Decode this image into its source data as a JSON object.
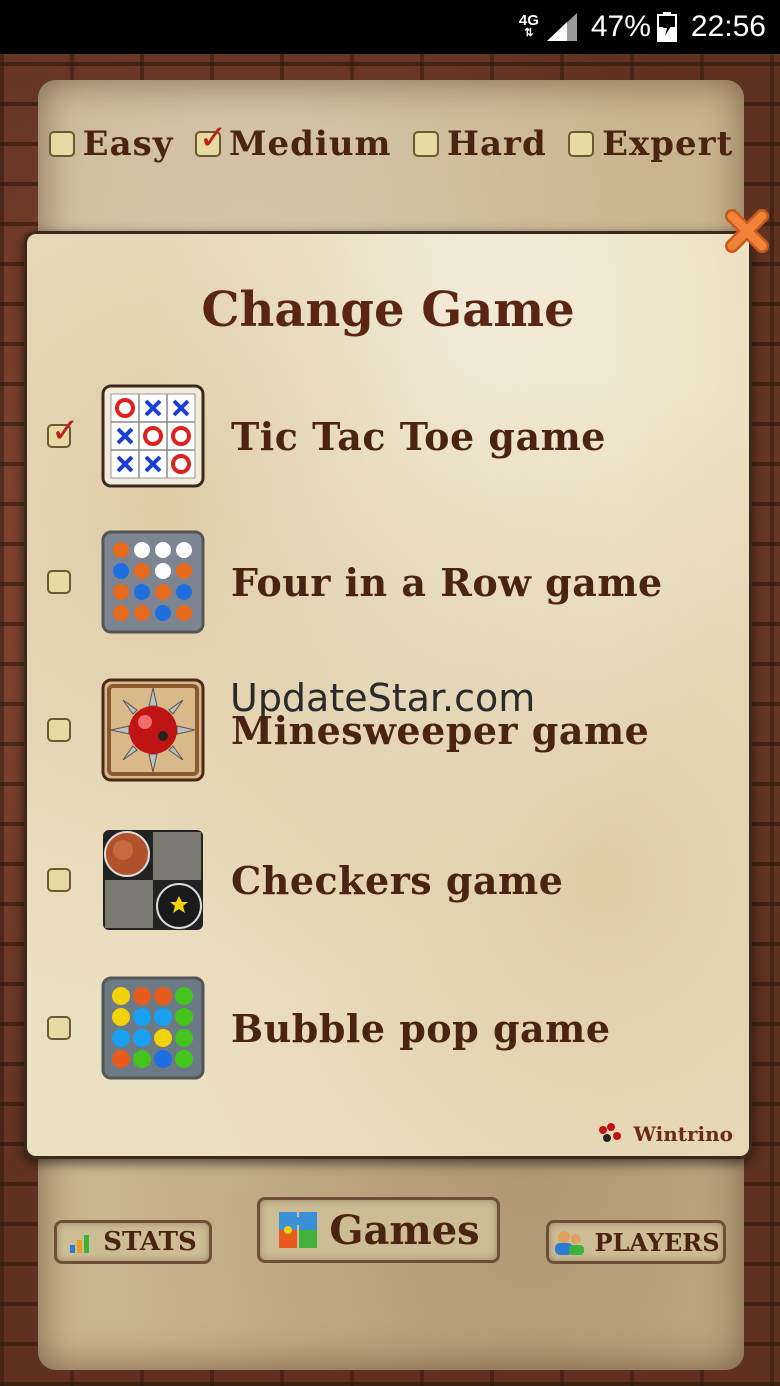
{
  "status_bar": {
    "network": "4G",
    "battery_percent": "47%",
    "time": "22:56"
  },
  "difficulty": {
    "options": [
      {
        "label": "Easy",
        "checked": false
      },
      {
        "label": "Medium",
        "checked": true
      },
      {
        "label": "Hard",
        "checked": false
      },
      {
        "label": "Expert",
        "checked": false
      }
    ]
  },
  "dialog": {
    "title": "Change Game",
    "games": [
      {
        "label": "Tic Tac Toe game",
        "icon": "tic-tac-toe-icon",
        "checked": true
      },
      {
        "label": "Four in a Row game",
        "icon": "four-in-a-row-icon",
        "checked": false
      },
      {
        "label": "Minesweeper game",
        "icon": "minesweeper-icon",
        "checked": false
      },
      {
        "label": "Checkers game",
        "icon": "checkers-icon",
        "checked": false
      },
      {
        "label": "Bubble pop game",
        "icon": "bubble-pop-icon",
        "checked": false
      }
    ],
    "brand": "Wintrino"
  },
  "watermark": "UpdateStar.com",
  "bottom_bar": {
    "stats": "STATS",
    "games": "Games",
    "players": "PLAYERS"
  },
  "colors": {
    "accent_red": "#c0201c",
    "text_brown": "#4a2410",
    "close_orange": "#e8732a"
  }
}
